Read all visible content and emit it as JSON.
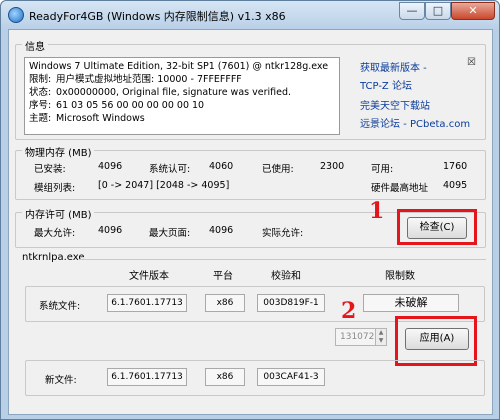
{
  "window": {
    "title": "ReadyFor4GB (Windows 内存限制信息) v1.3 x86",
    "minimize_glyph": "—",
    "maximize_glyph": "□",
    "close_glyph": "✕",
    "icon": "app-globe-icon"
  },
  "info_section": {
    "label": "信息",
    "lines": [
      {
        "key": "",
        "value": "Windows 7 Ultimate Edition, 32-bit SP1 (7601) @ ntkr128g.exe"
      },
      {
        "key": "限制:",
        "value": "用户模式虚拟地址范围:   10000 - 7FFEFFFF"
      },
      {
        "key": "状态:",
        "value": "0x00000000, Original file, signature was verified."
      },
      {
        "key": "序号:",
        "value": "61 03 05 56 00 00 00 00 00 10"
      },
      {
        "key": "主题:",
        "value": "Microsoft Windows"
      }
    ],
    "links": [
      "获取最新版本 -",
      "TCP-Z 论坛",
      "完美天空下载站",
      "远景论坛 - PCbeta.com"
    ],
    "pin_glyph": "☒"
  },
  "physical_memory": {
    "label": "物理内存 (MB)",
    "installed_label": "已安装:",
    "installed_value": "4096",
    "system_recognized_label": "系统认可:",
    "system_recognized_value": "4060",
    "used_label": "已使用:",
    "used_value": "2300",
    "available_label": "可用:",
    "available_value": "1760",
    "modules_label": "模组列表:",
    "modules_value": "[0 -> 2047]  [2048 -> 4095]",
    "max_address_label": "硬件最高地址",
    "max_address_value": "4095"
  },
  "memory_license": {
    "label": "内存许可 (MB)",
    "max_allowed_label": "最大允许:",
    "max_allowed_value": "4096",
    "max_page_label": "最大页面:",
    "max_page_value": "4096",
    "actual_allowed_label": "实际允许:",
    "actual_allowed_value": "",
    "check_button": "检查(C)"
  },
  "ntkrnlpa": {
    "label": "ntkrnlpa.exe",
    "columns": [
      "文件版本",
      "平台",
      "校验和",
      "限制数"
    ],
    "system_file_label": "系统文件:",
    "system_file": {
      "version": "6.1.7601.17713",
      "platform": "x86",
      "checksum": "003D819F-1",
      "limit": "未破解"
    },
    "spin_value": "131072",
    "apply_button": "应用(A)",
    "new_file_label": "新文件:",
    "new_file": {
      "version": "6.1.7601.17713",
      "platform": "x86",
      "checksum": "003CAF41-3",
      "limit": ""
    }
  },
  "annotations": {
    "mark_1": "1",
    "mark_2": "2",
    "color": "#e4161c"
  }
}
